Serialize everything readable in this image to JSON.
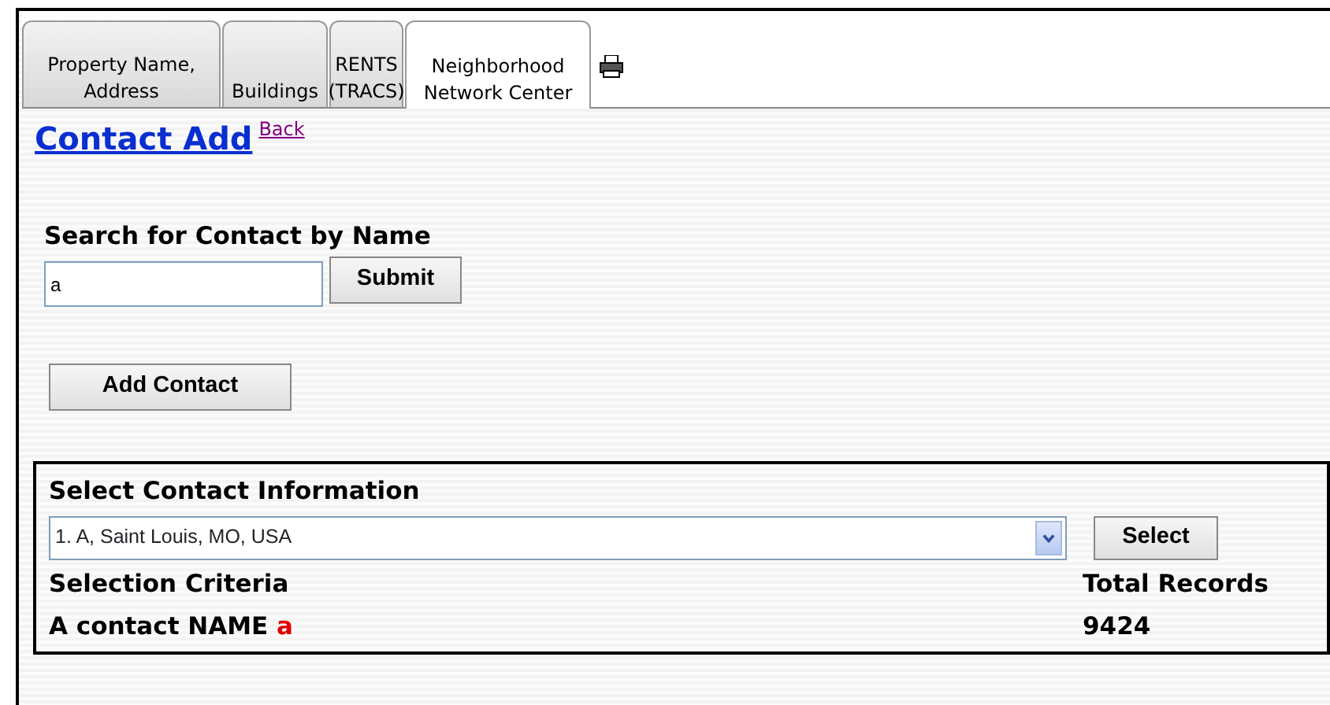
{
  "tabs": [
    {
      "label": "Property Name, Address",
      "selected": false
    },
    {
      "label": "Buildings",
      "selected": false
    },
    {
      "label": "RENTS (TRACS)",
      "selected": false
    },
    {
      "label": "Neighborhood Network Center",
      "selected": true
    }
  ],
  "page_title": "Contact Add",
  "back_link": "Back",
  "search": {
    "heading": "Search for Contact by Name",
    "value": "a",
    "submit": "Submit"
  },
  "add_button": "Add Contact",
  "results": {
    "heading": "Select Contact Information",
    "selected_option": "1. A, Saint Louis, MO, USA",
    "select_button": "Select",
    "criteria_heading": "Selection Criteria",
    "criteria_label": "A contact NAME",
    "criteria_value": "a",
    "total_heading": "Total Records",
    "total_value": "9424"
  }
}
